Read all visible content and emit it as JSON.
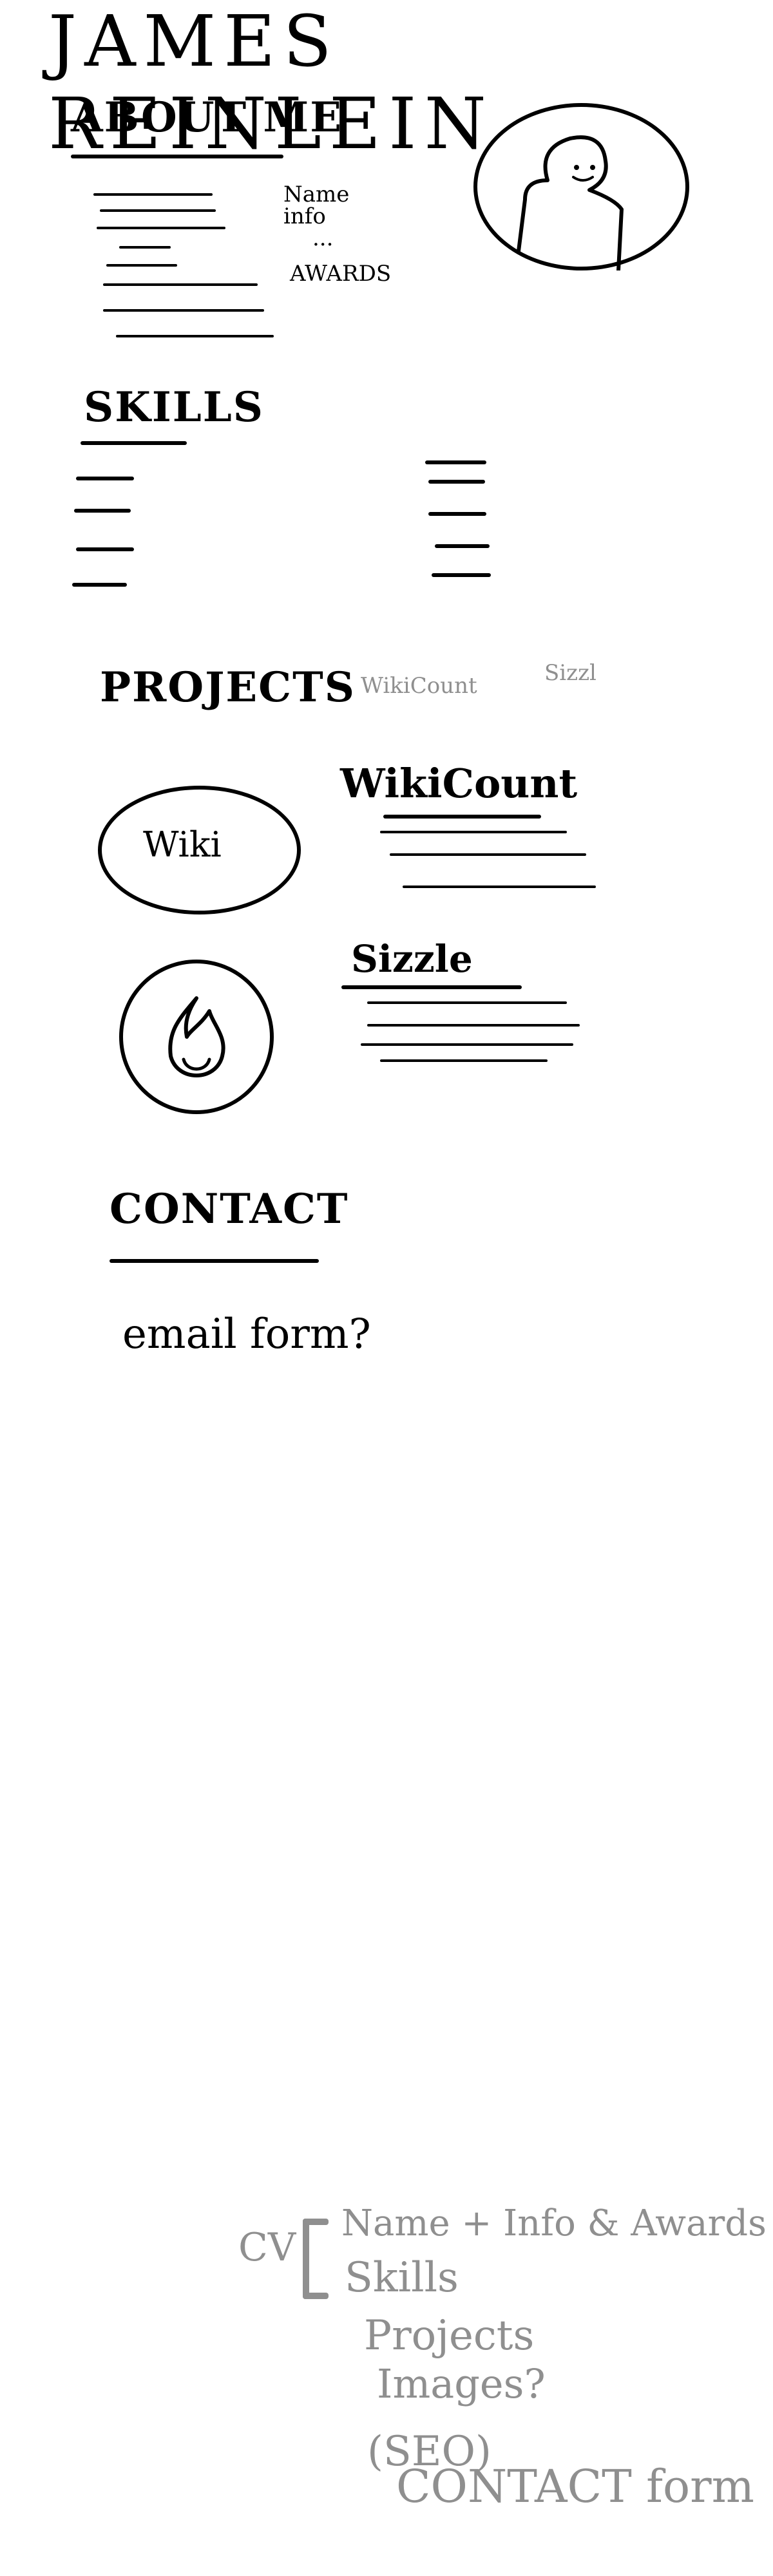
{
  "page": {
    "title": "JAMES REINLEIN"
  },
  "about": {
    "heading": "ABOUT ME",
    "name_info": "Name info",
    "ellipsis": "...",
    "awards": "AWARDS"
  },
  "skills": {
    "heading": "SKILLS"
  },
  "projects": {
    "heading": "PROJECTS",
    "wikicount_top": "WikiCount",
    "sizzl_top": "Sizzl",
    "wiki_badge": "Wiki",
    "wikicount_title": "WikiCount",
    "sizzle_title": "Sizzle"
  },
  "contact": {
    "heading": "CONTACT",
    "email_form": "email form?"
  },
  "notes": {
    "cv": "CV",
    "line1": "Name + Info & Awards",
    "line2": "Skills",
    "line3": "Projects",
    "line4": "Images?",
    "line5": "(SEO)",
    "line6": "CONTACT form"
  }
}
